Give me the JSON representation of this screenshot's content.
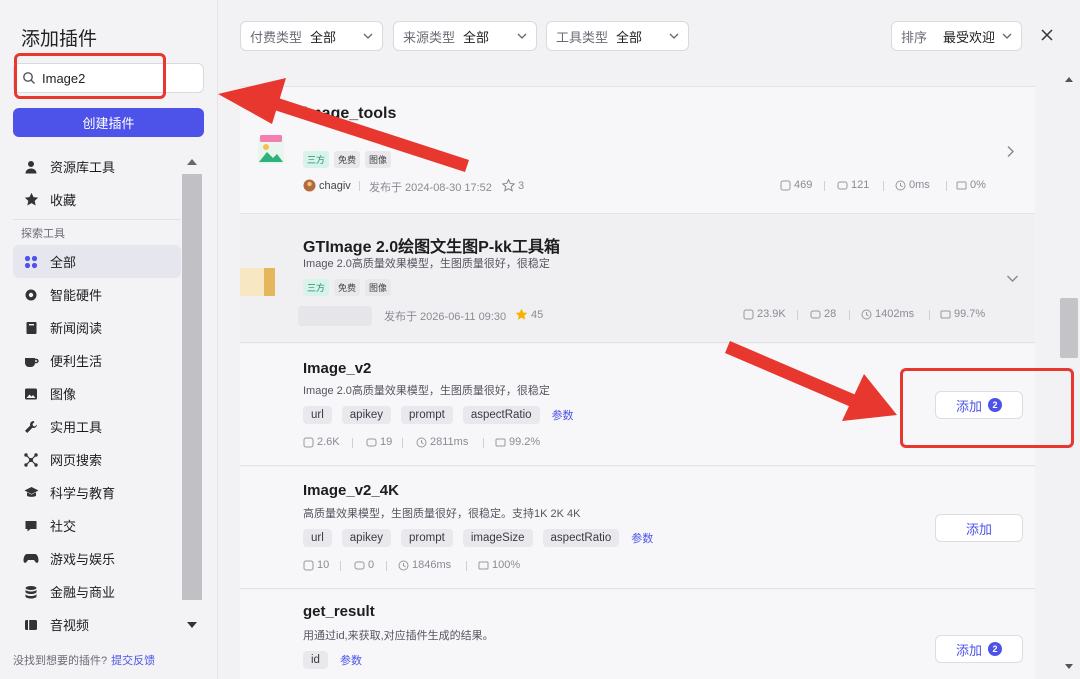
{
  "sidebar": {
    "title": "添加插件",
    "search_value": "Image2",
    "create_button": "创建插件",
    "items_top": [
      {
        "label": "资源库工具",
        "icon": "person-icon"
      },
      {
        "label": "收藏",
        "icon": "star-icon"
      }
    ],
    "section_label": "探索工具",
    "items": [
      {
        "label": "全部",
        "icon": "grid-icon",
        "active": true
      },
      {
        "label": "智能硬件",
        "icon": "chip-icon"
      },
      {
        "label": "新闻阅读",
        "icon": "book-icon"
      },
      {
        "label": "便利生活",
        "icon": "cup-icon"
      },
      {
        "label": "图像",
        "icon": "image-icon"
      },
      {
        "label": "实用工具",
        "icon": "wrench-icon"
      },
      {
        "label": "网页搜索",
        "icon": "network-icon"
      },
      {
        "label": "科学与教育",
        "icon": "graduation-icon"
      },
      {
        "label": "社交",
        "icon": "chat-icon"
      },
      {
        "label": "游戏与娱乐",
        "icon": "gamepad-icon"
      },
      {
        "label": "金融与商业",
        "icon": "coins-icon"
      },
      {
        "label": "音视频",
        "icon": "media-icon"
      }
    ],
    "footer_text": "没找到想要的插件?",
    "footer_link": "提交反馈"
  },
  "filters": {
    "pay": {
      "label": "付费类型",
      "value": "全部"
    },
    "source": {
      "label": "来源类型",
      "value": "全部"
    },
    "tool": {
      "label": "工具类型",
      "value": "全部"
    },
    "sort": {
      "label": "排序",
      "value": "最受欢迎"
    }
  },
  "plugins": [
    {
      "name": "image_tools",
      "tags": [
        "三方",
        "免费",
        "图像"
      ],
      "author": "chagiv",
      "published": "发布于 2024-08-30 17:52",
      "stars": "3",
      "stats": {
        "calls": "469",
        "bots": "121",
        "latency": "0ms",
        "success": "0%"
      }
    },
    {
      "name": "GTImage 2.0绘图文生图P-kk工具箱",
      "desc": "Image 2.0高质量效果模型，生图质量很好，很稳定",
      "tags": [
        "三方",
        "免费",
        "图像"
      ],
      "published": "发布于 2026-06-11 09:30",
      "stars": "45",
      "stats": {
        "calls": "23.9K",
        "bots": "28",
        "latency": "1402ms",
        "success": "99.7%"
      }
    }
  ],
  "tools": [
    {
      "name": "Image_v2",
      "desc": "Image 2.0高质量效果模型，生图质量很好，很稳定",
      "params": [
        "url",
        "apikey",
        "prompt",
        "aspectRatio"
      ],
      "params_link": "参数",
      "stats": {
        "calls": "2.6K",
        "bots": "19",
        "latency": "2811ms",
        "success": "99.2%"
      },
      "add_label": "添加",
      "badge": "2"
    },
    {
      "name": "Image_v2_4K",
      "desc": "高质量效果模型，生图质量很好，很稳定。支持1K 2K 4K",
      "params": [
        "url",
        "apikey",
        "prompt",
        "imageSize",
        "aspectRatio"
      ],
      "params_link": "参数",
      "stats": {
        "calls": "10",
        "bots": "0",
        "latency": "1846ms",
        "success": "100%"
      },
      "add_label": "添加"
    },
    {
      "name": "get_result",
      "desc": "用通过id,来获取,对应插件生成的结果。",
      "params": [
        "id"
      ],
      "params_link": "参数",
      "add_label": "添加",
      "badge": "2"
    }
  ],
  "colors": {
    "accent": "#4d53e8",
    "annotation": "#e8372f"
  }
}
